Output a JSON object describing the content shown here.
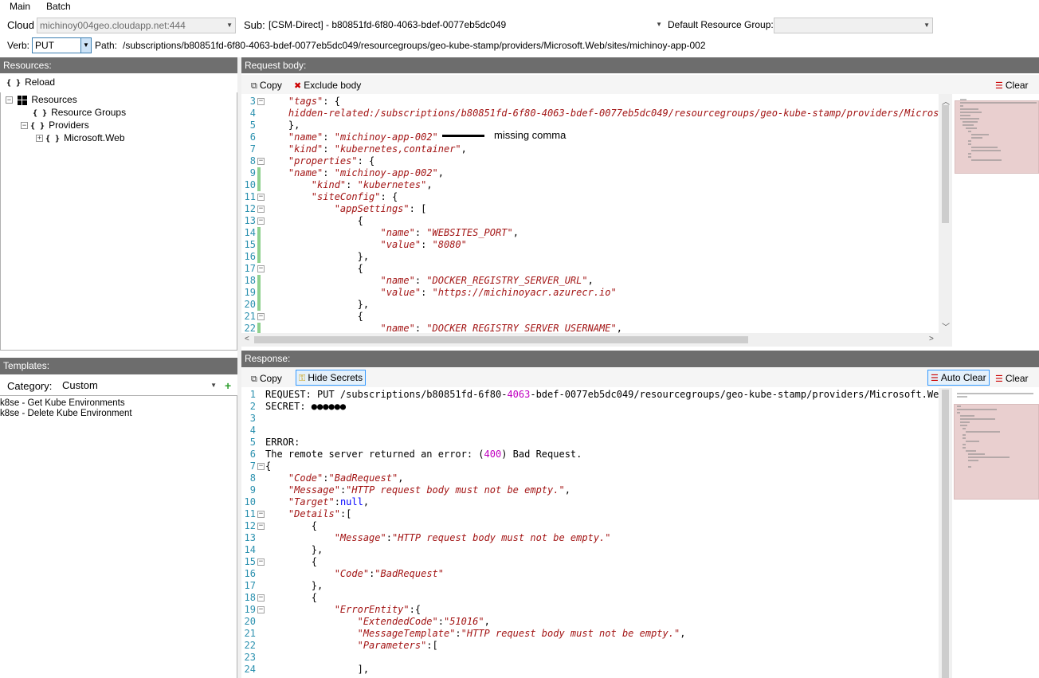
{
  "menu": {
    "main": "Main",
    "batch": "Batch"
  },
  "top": {
    "cloud_label": "Cloud",
    "cloud_value": "michinoy004geo.cloudapp.net:444",
    "sub_label": "Sub:",
    "sub_value": "[CSM-Direct] - b80851fd-6f80-4063-bdef-0077eb5dc049",
    "rg_label": "Default Resource Group:",
    "rg_value": "",
    "verb_label": "Verb:",
    "verb_value": "PUT",
    "path_label": "Path:",
    "path_value": "/subscriptions/b80851fd-6f80-4063-bdef-0077eb5dc049/resourcegroups/geo-kube-stamp/providers/Microsoft.Web/sites/michinoy-app-002"
  },
  "resources": {
    "header": "Resources:",
    "reload": "Reload",
    "tree": {
      "root": "Resources",
      "groups": "Resource Groups",
      "providers": "Providers",
      "msweb": "Microsoft.Web"
    }
  },
  "templates": {
    "header": "Templates:",
    "category_label": "Category:",
    "category_value": "Custom",
    "items": [
      "k8se - Get Kube Environments",
      "k8se - Delete Kube Environment"
    ]
  },
  "request": {
    "header": "Request body:",
    "copy": "Copy",
    "exclude": "Exclude body",
    "clear": "Clear",
    "annotation": "missing comma",
    "lines": [
      {
        "n": "3",
        "fold": true,
        "html": "    <span class='k'>\"tags\"</span>: {"
      },
      {
        "n": "4",
        "fold": false,
        "html": "    <span class='k'>hidden-related:/subscriptions/b80851fd-6f80-4063-bdef-0077eb5dc049/resourcegroups/geo-kube-stamp/providers/Microsoft</span>"
      },
      {
        "n": "5",
        "fold": false,
        "html": "    },"
      },
      {
        "n": "6",
        "fold": false,
        "html": "    <span class='k'>\"name\"</span>: <span class='s'>\"michinoy-app-002\"</span>"
      },
      {
        "n": "7",
        "fold": false,
        "html": "    <span class='k'>\"kind\"</span>: <span class='s'>\"kubernetes,container\"</span>,"
      },
      {
        "n": "8",
        "fold": true,
        "html": "    <span class='k'>\"properties\"</span>: {"
      },
      {
        "n": "9",
        "fold": false,
        "html": "    <span class='k'>\"name\"</span>: <span class='s'>\"michinoy-app-002\"</span>,"
      },
      {
        "n": "10",
        "fold": false,
        "html": "        <span class='k'>\"kind\"</span>: <span class='s'>\"kubernetes\"</span>,"
      },
      {
        "n": "11",
        "fold": true,
        "html": "        <span class='k'>\"siteConfig\"</span>: {"
      },
      {
        "n": "12",
        "fold": true,
        "html": "            <span class='k'>\"appSettings\"</span>: ["
      },
      {
        "n": "13",
        "fold": true,
        "html": "                {"
      },
      {
        "n": "14",
        "fold": false,
        "html": "                    <span class='k'>\"name\"</span>: <span class='s'>\"WEBSITES_PORT\"</span>,"
      },
      {
        "n": "15",
        "fold": false,
        "html": "                    <span class='k'>\"value\"</span>: <span class='s'>\"8080\"</span>"
      },
      {
        "n": "16",
        "fold": false,
        "html": "                },"
      },
      {
        "n": "17",
        "fold": true,
        "html": "                {"
      },
      {
        "n": "18",
        "fold": false,
        "html": "                    <span class='k'>\"name\"</span>: <span class='s'>\"DOCKER_REGISTRY_SERVER_URL\"</span>,"
      },
      {
        "n": "19",
        "fold": false,
        "html": "                    <span class='k'>\"value\"</span>: <span class='s'>\"https://michinoyacr.azurecr.io\"</span>"
      },
      {
        "n": "20",
        "fold": false,
        "html": "                },"
      },
      {
        "n": "21",
        "fold": true,
        "html": "                {"
      },
      {
        "n": "22",
        "fold": false,
        "html": "                    <span class='k'>\"name\"</span>: <span class='s'>\"DOCKER_REGISTRY_SERVER_USERNAME\"</span>,"
      }
    ]
  },
  "response": {
    "header": "Response:",
    "copy": "Copy",
    "hide_secrets": "Hide Secrets",
    "auto_clear": "Auto Clear",
    "clear": "Clear",
    "lines": [
      {
        "n": "1",
        "fold": false,
        "html": "REQUEST: PUT /subscriptions/b80851fd-6f80-<span class='m'>4063</span>-bdef-0077eb5dc049/resourcegroups/geo-kube-stamp/providers/Microsoft.Web/s"
      },
      {
        "n": "2",
        "fold": false,
        "html": "SECRET: ●●●●●●"
      },
      {
        "n": "3",
        "fold": false,
        "html": ""
      },
      {
        "n": "4",
        "fold": false,
        "html": ""
      },
      {
        "n": "5",
        "fold": false,
        "html": "ERROR:"
      },
      {
        "n": "6",
        "fold": false,
        "html": "The remote server returned an error: (<span class='m'>400</span>) Bad Request."
      },
      {
        "n": "7",
        "fold": true,
        "html": "{"
      },
      {
        "n": "8",
        "fold": false,
        "html": "    <span class='k'>\"Code\"</span>:<span class='s'>\"BadRequest\"</span>,"
      },
      {
        "n": "9",
        "fold": false,
        "html": "    <span class='k'>\"Message\"</span>:<span class='s'>\"HTTP request body must not be empty.\"</span>,"
      },
      {
        "n": "10",
        "fold": false,
        "html": "    <span class='k'>\"Target\"</span>:<span class='b'>null</span>,"
      },
      {
        "n": "11",
        "fold": true,
        "html": "    <span class='k'>\"Details\"</span>:["
      },
      {
        "n": "12",
        "fold": true,
        "html": "        {"
      },
      {
        "n": "13",
        "fold": false,
        "html": "            <span class='k'>\"Message\"</span>:<span class='s'>\"HTTP request body must not be empty.\"</span>"
      },
      {
        "n": "14",
        "fold": false,
        "html": "        },"
      },
      {
        "n": "15",
        "fold": true,
        "html": "        {"
      },
      {
        "n": "16",
        "fold": false,
        "html": "            <span class='k'>\"Code\"</span>:<span class='s'>\"BadRequest\"</span>"
      },
      {
        "n": "17",
        "fold": false,
        "html": "        },"
      },
      {
        "n": "18",
        "fold": true,
        "html": "        {"
      },
      {
        "n": "19",
        "fold": true,
        "html": "            <span class='k'>\"ErrorEntity\"</span>:{"
      },
      {
        "n": "20",
        "fold": false,
        "html": "                <span class='k'>\"ExtendedCode\"</span>:<span class='s'>\"51016\"</span>,"
      },
      {
        "n": "21",
        "fold": false,
        "html": "                <span class='k'>\"MessageTemplate\"</span>:<span class='s'>\"HTTP request body must not be empty.\"</span>,"
      },
      {
        "n": "22",
        "fold": false,
        "html": "                <span class='k'>\"Parameters\"</span>:["
      },
      {
        "n": "23",
        "fold": false,
        "html": ""
      },
      {
        "n": "24",
        "fold": false,
        "html": "                ],"
      }
    ]
  }
}
